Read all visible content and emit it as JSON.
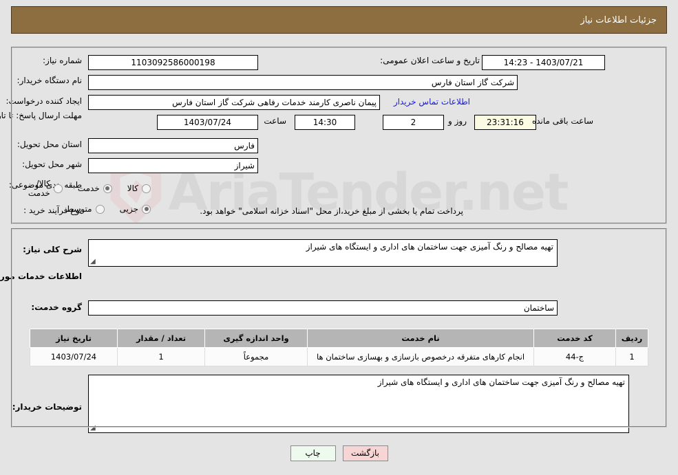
{
  "header": {
    "title": "جزئیات اطلاعات نیاز"
  },
  "watermark": {
    "text": "AriaTender.net"
  },
  "top_form": {
    "need_number_label": "شماره نیاز:",
    "need_number_value": "1103092586000198",
    "announce_datetime_label": "تاریخ و ساعت اعلان عمومی:",
    "announce_datetime_value": "1403/07/21 - 14:23",
    "buyer_org_label": "نام دستگاه خریدار:",
    "buyer_org_value": "شرکت گاز استان فارس",
    "requester_label": "ایجاد کننده درخواست:",
    "requester_value": "پیمان ناصری کارمند خدمات رفاهی شرکت گاز استان فارس",
    "contact_link": "اطلاعات تماس خریدار",
    "deadline_label": "مهلت ارسال پاسخ: تا تاریخ:",
    "deadline_date": "1403/07/24",
    "deadline_hour_label": "ساعت",
    "deadline_hour": "14:30",
    "remaining_days": "2",
    "days_and_label": "روز و",
    "remaining_time": "23:31:16",
    "remaining_suffix": "ساعت باقی مانده",
    "province_label": "استان محل تحویل:",
    "province_value": "فارس",
    "city_label": "شهر محل تحویل:",
    "city_value": "شیراز",
    "category_label": "طبقه بندی موضوعی:",
    "category_options": [
      {
        "label": "کالا",
        "checked": false
      },
      {
        "label": "خدمت",
        "checked": true
      },
      {
        "label": "کالا/خدمت",
        "checked": false
      }
    ],
    "process_label": "نوع فرآیند خرید :",
    "process_options": [
      {
        "label": "جزیی",
        "checked": true
      },
      {
        "label": "متوسط",
        "checked": false
      }
    ],
    "treasury_note": "پرداخت تمام یا بخشی از مبلغ خرید،از محل \"اسناد خزانه اسلامی\" خواهد بود."
  },
  "middle": {
    "summary_label": "شرح کلی نیاز:",
    "summary_value": "تهیه مصالح و رنگ آمیزی جهت ساختمان های اداری و ایستگاه های شیراز",
    "services_heading": "اطلاعات خدمات مورد نیاز",
    "service_group_label": "گروه خدمت:",
    "service_group_value": "ساختمان",
    "buyer_notes_label": "توضیحات خریدار:",
    "buyer_notes_value": "تهیه مصالح و رنگ آمیزی جهت ساختمان های اداری و ایستگاه های شیراز"
  },
  "table": {
    "columns": [
      "ردیف",
      "کد خدمت",
      "نام خدمت",
      "واحد اندازه گیری",
      "تعداد / مقدار",
      "تاریخ نیاز"
    ],
    "rows": [
      {
        "index": "1",
        "code": "ج-44",
        "name": "انجام کارهای متفرقه درخصوص بازسازی و بهسازی ساختمان ها",
        "unit": "مجموعاً",
        "quantity": "1",
        "need_date": "1403/07/24"
      }
    ]
  },
  "buttons": {
    "back": "بازگشت",
    "print": "چاپ"
  },
  "colors": {
    "header_bg": "#8d6e41",
    "page_bg": "#e4e4e4",
    "link": "#1717e0",
    "table_header_bg": "#b5b5b5",
    "btn_back_bg": "#f8d5d5",
    "btn_print_bg": "#eefaee",
    "countdown_bg": "#fbfbe4"
  }
}
